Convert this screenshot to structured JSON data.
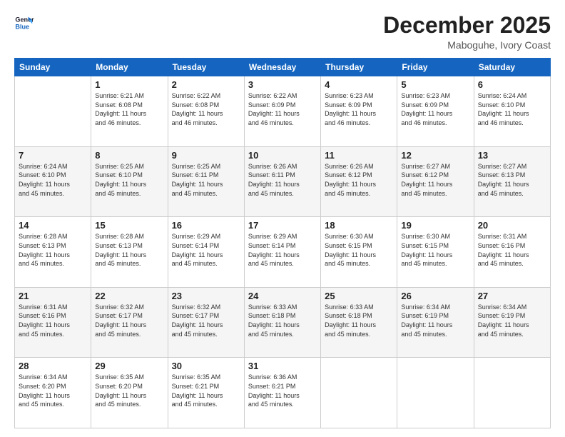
{
  "logo": {
    "line1": "General",
    "line2": "Blue"
  },
  "title": "December 2025",
  "location": "Maboguhe, Ivory Coast",
  "days_of_week": [
    "Sunday",
    "Monday",
    "Tuesday",
    "Wednesday",
    "Thursday",
    "Friday",
    "Saturday"
  ],
  "weeks": [
    [
      {
        "day": "",
        "info": ""
      },
      {
        "day": "1",
        "info": "Sunrise: 6:21 AM\nSunset: 6:08 PM\nDaylight: 11 hours\nand 46 minutes."
      },
      {
        "day": "2",
        "info": "Sunrise: 6:22 AM\nSunset: 6:08 PM\nDaylight: 11 hours\nand 46 minutes."
      },
      {
        "day": "3",
        "info": "Sunrise: 6:22 AM\nSunset: 6:09 PM\nDaylight: 11 hours\nand 46 minutes."
      },
      {
        "day": "4",
        "info": "Sunrise: 6:23 AM\nSunset: 6:09 PM\nDaylight: 11 hours\nand 46 minutes."
      },
      {
        "day": "5",
        "info": "Sunrise: 6:23 AM\nSunset: 6:09 PM\nDaylight: 11 hours\nand 46 minutes."
      },
      {
        "day": "6",
        "info": "Sunrise: 6:24 AM\nSunset: 6:10 PM\nDaylight: 11 hours\nand 46 minutes."
      }
    ],
    [
      {
        "day": "7",
        "info": "Sunrise: 6:24 AM\nSunset: 6:10 PM\nDaylight: 11 hours\nand 45 minutes."
      },
      {
        "day": "8",
        "info": "Sunrise: 6:25 AM\nSunset: 6:10 PM\nDaylight: 11 hours\nand 45 minutes."
      },
      {
        "day": "9",
        "info": "Sunrise: 6:25 AM\nSunset: 6:11 PM\nDaylight: 11 hours\nand 45 minutes."
      },
      {
        "day": "10",
        "info": "Sunrise: 6:26 AM\nSunset: 6:11 PM\nDaylight: 11 hours\nand 45 minutes."
      },
      {
        "day": "11",
        "info": "Sunrise: 6:26 AM\nSunset: 6:12 PM\nDaylight: 11 hours\nand 45 minutes."
      },
      {
        "day": "12",
        "info": "Sunrise: 6:27 AM\nSunset: 6:12 PM\nDaylight: 11 hours\nand 45 minutes."
      },
      {
        "day": "13",
        "info": "Sunrise: 6:27 AM\nSunset: 6:13 PM\nDaylight: 11 hours\nand 45 minutes."
      }
    ],
    [
      {
        "day": "14",
        "info": "Sunrise: 6:28 AM\nSunset: 6:13 PM\nDaylight: 11 hours\nand 45 minutes."
      },
      {
        "day": "15",
        "info": "Sunrise: 6:28 AM\nSunset: 6:13 PM\nDaylight: 11 hours\nand 45 minutes."
      },
      {
        "day": "16",
        "info": "Sunrise: 6:29 AM\nSunset: 6:14 PM\nDaylight: 11 hours\nand 45 minutes."
      },
      {
        "day": "17",
        "info": "Sunrise: 6:29 AM\nSunset: 6:14 PM\nDaylight: 11 hours\nand 45 minutes."
      },
      {
        "day": "18",
        "info": "Sunrise: 6:30 AM\nSunset: 6:15 PM\nDaylight: 11 hours\nand 45 minutes."
      },
      {
        "day": "19",
        "info": "Sunrise: 6:30 AM\nSunset: 6:15 PM\nDaylight: 11 hours\nand 45 minutes."
      },
      {
        "day": "20",
        "info": "Sunrise: 6:31 AM\nSunset: 6:16 PM\nDaylight: 11 hours\nand 45 minutes."
      }
    ],
    [
      {
        "day": "21",
        "info": "Sunrise: 6:31 AM\nSunset: 6:16 PM\nDaylight: 11 hours\nand 45 minutes."
      },
      {
        "day": "22",
        "info": "Sunrise: 6:32 AM\nSunset: 6:17 PM\nDaylight: 11 hours\nand 45 minutes."
      },
      {
        "day": "23",
        "info": "Sunrise: 6:32 AM\nSunset: 6:17 PM\nDaylight: 11 hours\nand 45 minutes."
      },
      {
        "day": "24",
        "info": "Sunrise: 6:33 AM\nSunset: 6:18 PM\nDaylight: 11 hours\nand 45 minutes."
      },
      {
        "day": "25",
        "info": "Sunrise: 6:33 AM\nSunset: 6:18 PM\nDaylight: 11 hours\nand 45 minutes."
      },
      {
        "day": "26",
        "info": "Sunrise: 6:34 AM\nSunset: 6:19 PM\nDaylight: 11 hours\nand 45 minutes."
      },
      {
        "day": "27",
        "info": "Sunrise: 6:34 AM\nSunset: 6:19 PM\nDaylight: 11 hours\nand 45 minutes."
      }
    ],
    [
      {
        "day": "28",
        "info": "Sunrise: 6:34 AM\nSunset: 6:20 PM\nDaylight: 11 hours\nand 45 minutes."
      },
      {
        "day": "29",
        "info": "Sunrise: 6:35 AM\nSunset: 6:20 PM\nDaylight: 11 hours\nand 45 minutes."
      },
      {
        "day": "30",
        "info": "Sunrise: 6:35 AM\nSunset: 6:21 PM\nDaylight: 11 hours\nand 45 minutes."
      },
      {
        "day": "31",
        "info": "Sunrise: 6:36 AM\nSunset: 6:21 PM\nDaylight: 11 hours\nand 45 minutes."
      },
      {
        "day": "",
        "info": ""
      },
      {
        "day": "",
        "info": ""
      },
      {
        "day": "",
        "info": ""
      }
    ]
  ]
}
